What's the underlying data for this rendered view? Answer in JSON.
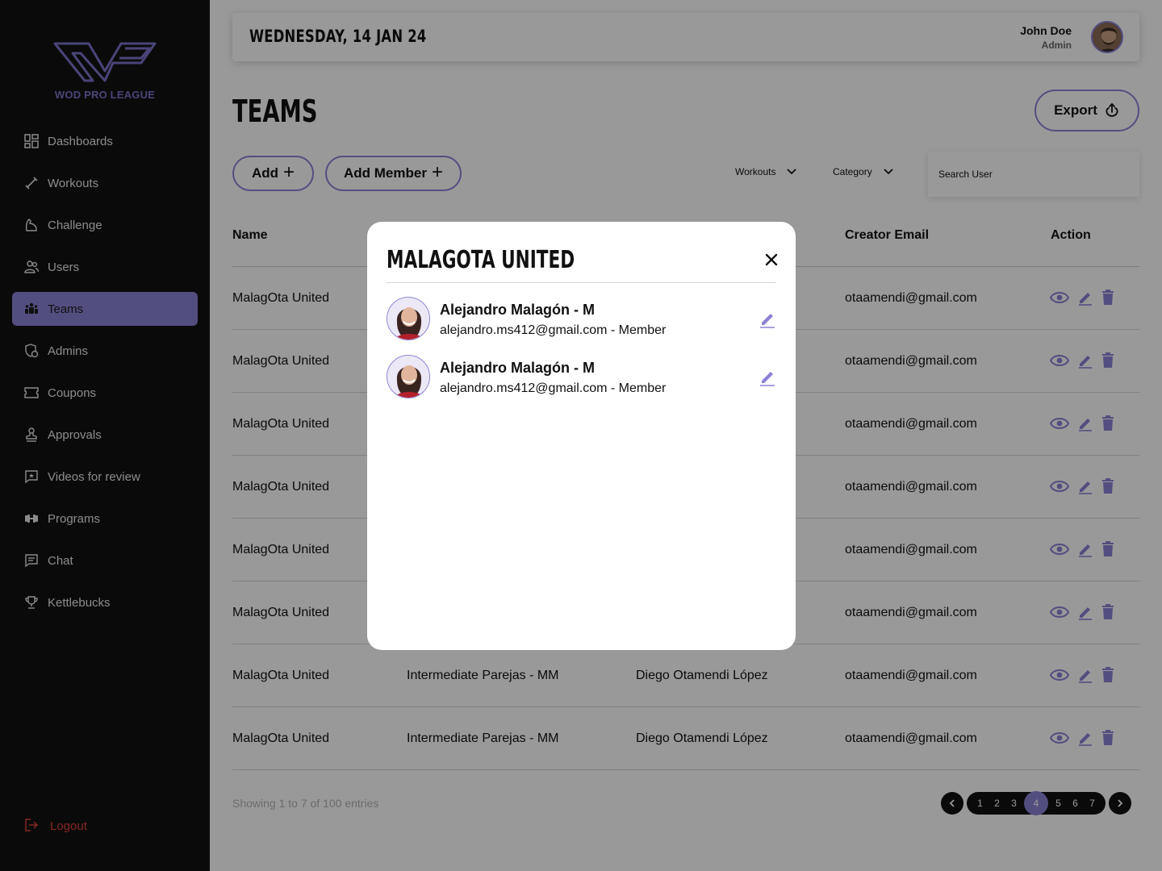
{
  "brand": {
    "name": "WOD PRO LEAGUE"
  },
  "sidebar": {
    "items": [
      {
        "label": "Dashboards",
        "icon": "dashboard-icon"
      },
      {
        "label": "Workouts",
        "icon": "dumbbell-icon"
      },
      {
        "label": "Challenge",
        "icon": "flex-arm-icon"
      },
      {
        "label": "Users",
        "icon": "users-icon"
      },
      {
        "label": "Teams",
        "icon": "teams-icon",
        "active": true
      },
      {
        "label": "Admins",
        "icon": "admin-icon"
      },
      {
        "label": "Coupons",
        "icon": "coupon-icon"
      },
      {
        "label": "Approvals",
        "icon": "stamp-icon"
      },
      {
        "label": "Videos for review",
        "icon": "video-review-icon"
      },
      {
        "label": "Programs",
        "icon": "weight-icon"
      },
      {
        "label": "Chat",
        "icon": "chat-icon"
      },
      {
        "label": "Kettlebucks",
        "icon": "trophy-icon"
      }
    ],
    "logout": "Logout"
  },
  "header": {
    "date": "WEDNESDAY, 14 JAN 24",
    "user_name": "John Doe",
    "user_role": "Admin"
  },
  "page": {
    "title": "TEAMS",
    "export_label": "Export",
    "add_label": "Add",
    "add_member_label": "Add Member",
    "filter_workouts": "Workouts",
    "filter_category": "Category",
    "search_placeholder": "Search User"
  },
  "table": {
    "headers": [
      "Name",
      "Creator Email",
      "Action"
    ],
    "rows": [
      {
        "name": "MalagOta United",
        "category": "",
        "creator": "",
        "email": "otaamendi@gmail.com"
      },
      {
        "name": "MalagOta United",
        "category": "",
        "creator": "",
        "email": "otaamendi@gmail.com"
      },
      {
        "name": "MalagOta United",
        "category": "",
        "creator": "",
        "email": "otaamendi@gmail.com"
      },
      {
        "name": "MalagOta United",
        "category": "",
        "creator": "",
        "email": "otaamendi@gmail.com"
      },
      {
        "name": "MalagOta United",
        "category": "",
        "creator": "",
        "email": "otaamendi@gmail.com"
      },
      {
        "name": "MalagOta United",
        "category": "",
        "creator": "",
        "email": "otaamendi@gmail.com"
      },
      {
        "name": "MalagOta United",
        "category": "Intermediate Parejas - MM",
        "creator": "Diego Otamendi López",
        "email": "otaamendi@gmail.com"
      },
      {
        "name": "MalagOta United",
        "category": "Intermediate Parejas - MM",
        "creator": "Diego Otamendi López",
        "email": "otaamendi@gmail.com"
      }
    ],
    "entries_text": "Showing 1 to 7 of 100 entries"
  },
  "pagination": {
    "pages": [
      "1",
      "2",
      "3",
      "4",
      "5",
      "6",
      "7"
    ],
    "current": "4"
  },
  "modal": {
    "title": "MALAGOTA UNITED",
    "members": [
      {
        "name": "Alejandro Malagón - M",
        "detail": "alejandro.ms412@gmail.com - Member"
      },
      {
        "name": "Alejandro Malagón - M",
        "detail": "alejandro.ms412@gmail.com - Member"
      }
    ]
  },
  "colors": {
    "accent": "#8b82d6",
    "sidebar_bg": "#111111",
    "logout": "#e0413a"
  }
}
